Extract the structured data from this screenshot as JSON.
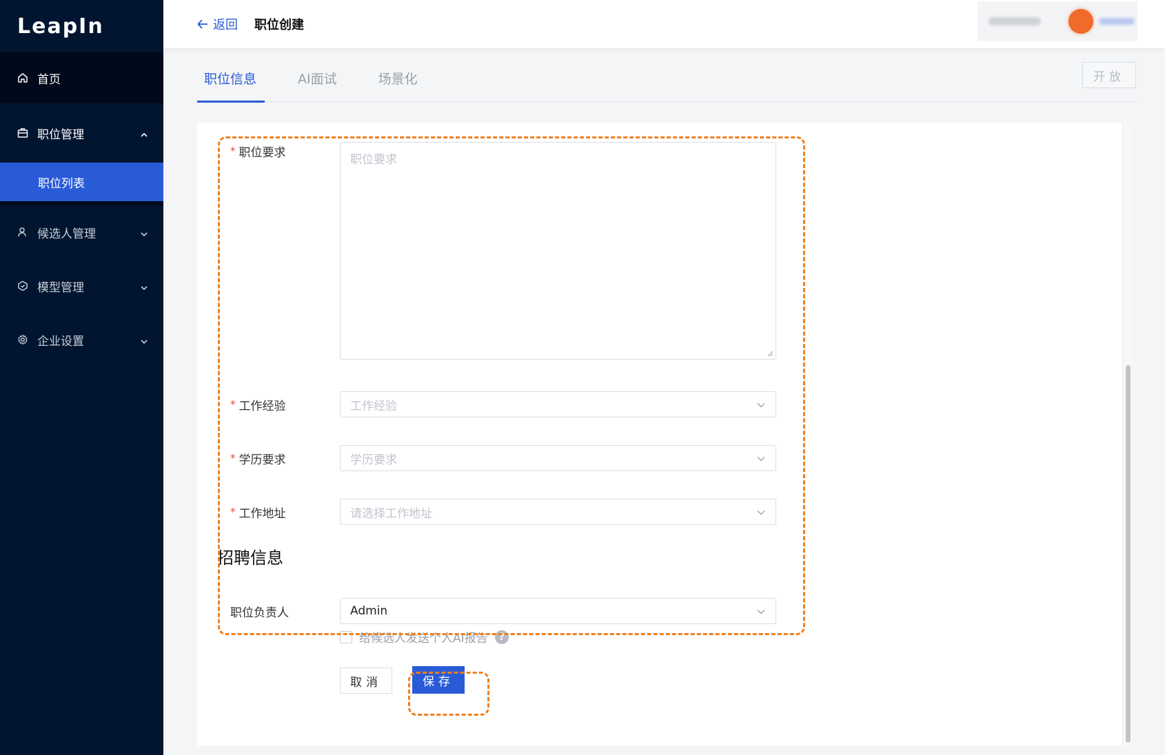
{
  "app": {
    "logo": "LeapIn"
  },
  "sidebar": {
    "items": [
      {
        "label": "首页",
        "icon": "home-icon"
      },
      {
        "label": "职位管理",
        "icon": "briefcase-icon",
        "expanded": true,
        "children": [
          {
            "label": "职位列表",
            "active": true
          }
        ]
      },
      {
        "label": "候选人管理",
        "icon": "user-icon"
      },
      {
        "label": "模型管理",
        "icon": "model-icon"
      },
      {
        "label": "企业设置",
        "icon": "settings-icon"
      }
    ]
  },
  "header": {
    "back_label": "返回",
    "title": "职位创建"
  },
  "tabs": [
    {
      "label": "职位信息",
      "active": true
    },
    {
      "label": "AI面试"
    },
    {
      "label": "场景化"
    }
  ],
  "toolbar": {
    "open_label": "开放"
  },
  "form": {
    "requirements": {
      "label": "职位要求",
      "placeholder": "职位要求",
      "required": true
    },
    "experience": {
      "label": "工作经验",
      "placeholder": "工作经验",
      "required": true
    },
    "education": {
      "label": "学历要求",
      "placeholder": "学历要求",
      "required": true
    },
    "location": {
      "label": "工作地址",
      "placeholder": "请选择工作地址",
      "required": true
    },
    "recruit_section_title": "招聘信息",
    "owner": {
      "label": "职位负责人",
      "value": "Admin"
    },
    "send_report": {
      "label": "给候选人发送个人AI报告",
      "checked": false,
      "help": "?"
    },
    "cancel_label": "取消",
    "save_label": "保存",
    "required_mark": "*"
  },
  "colors": {
    "primary": "#2a5bd7",
    "sidebar_bg": "#021530",
    "highlight": "#f07f1e",
    "required": "#e5483a"
  }
}
